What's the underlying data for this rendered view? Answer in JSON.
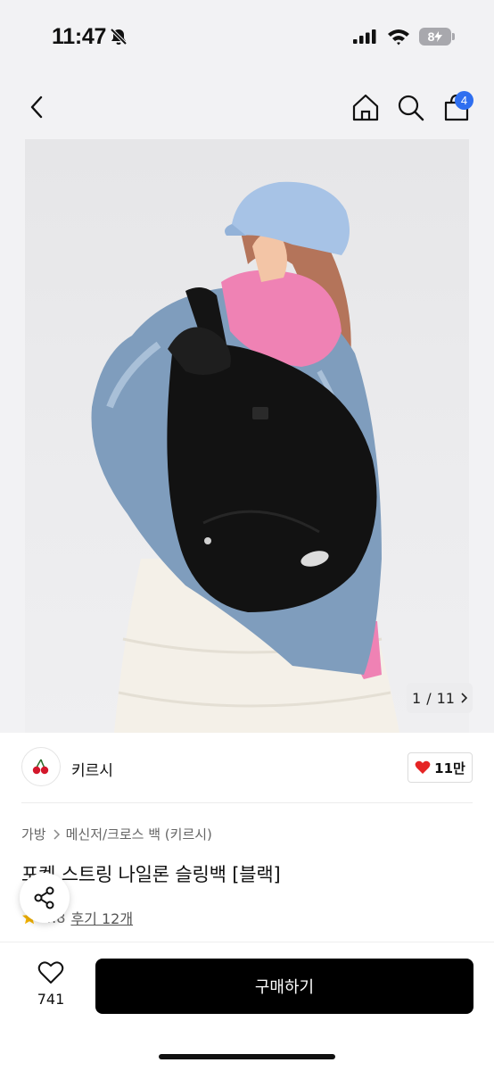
{
  "status_bar": {
    "time": "11:47",
    "battery": "8"
  },
  "header": {
    "cart_count": "4",
    "icons": [
      "back-icon",
      "home-icon",
      "search-icon",
      "cart-icon"
    ]
  },
  "gallery": {
    "counter_current": "1",
    "counter_separator": "/",
    "counter_total": "11"
  },
  "brand": {
    "name": "키르시",
    "likes": "11만"
  },
  "breadcrumb": {
    "category": "가방",
    "subcategory": "메신저/크로스 백 (키르시)"
  },
  "product": {
    "title": "포켓 스트링 나일론 슬링백 [블랙]",
    "rating": "4.8",
    "reviews_label": "후기 12개"
  },
  "bottom_bar": {
    "wish_count": "741",
    "buy_label": "구매하기"
  },
  "colors": {
    "accent_badge": "#2f6ff0",
    "like_heart": "#e52525",
    "buy_button": "#000000"
  }
}
